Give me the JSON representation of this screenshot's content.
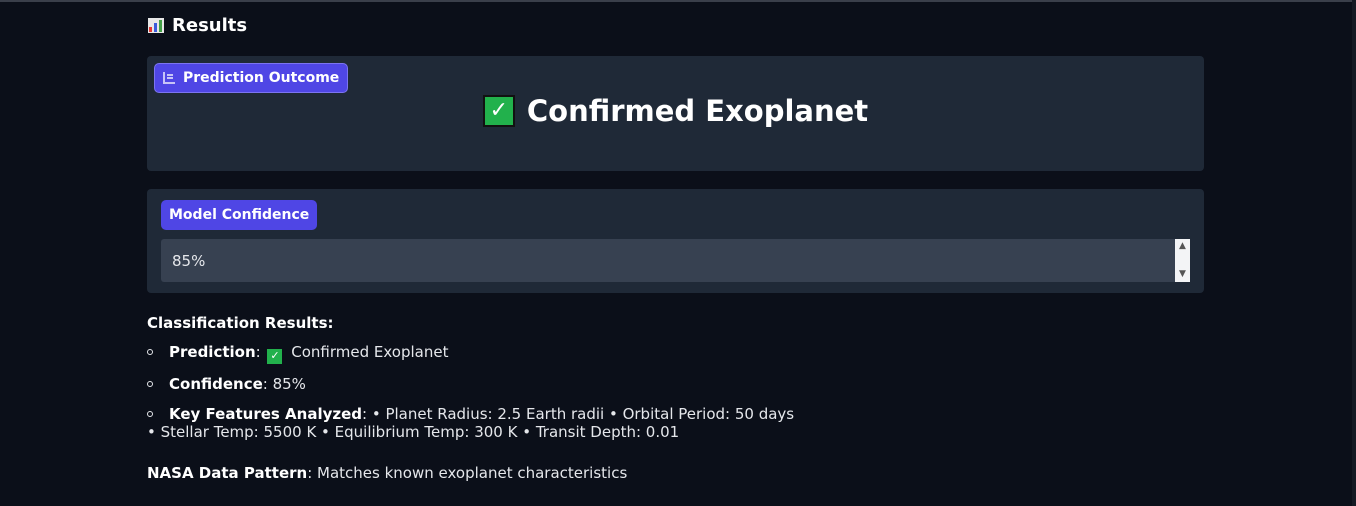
{
  "results": {
    "title": "Results",
    "icon": "bar-chart-icon"
  },
  "outcome_panel": {
    "badge_label": "Prediction Outcome",
    "outcome_text": "Confirmed Exoplanet",
    "outcome_icon": "check-icon"
  },
  "confidence_panel": {
    "badge_label": "Model Confidence",
    "value": "85%"
  },
  "classification": {
    "heading": "Classification Results:",
    "prediction_label": "Prediction",
    "prediction_value": "Confirmed Exoplanet",
    "confidence_label": "Confidence",
    "confidence_value": "85%",
    "features_label": "Key Features Analyzed",
    "features_line1": "• Planet Radius: 2.5 Earth radii • Orbital Period: 50 days",
    "features_line2": "• Stellar Temp: 5500 K • Equilibrium Temp: 300 K • Transit Depth: 0.01",
    "nasa_label": "NASA Data Pattern",
    "nasa_value": "Matches known exoplanet characteristics"
  },
  "colors": {
    "background": "#0b0f19",
    "panel": "#1f2937",
    "badge": "#4f46e5",
    "input": "#374151",
    "check": "#22b14c"
  }
}
